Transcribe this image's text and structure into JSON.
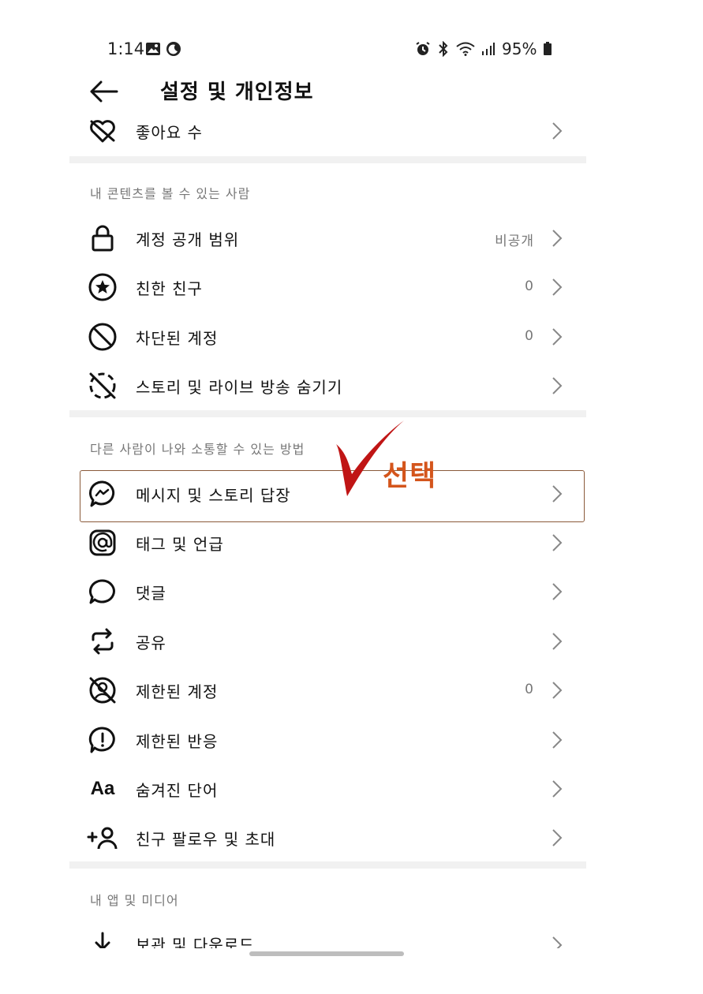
{
  "status_bar": {
    "time": "1:14",
    "battery": "95%"
  },
  "header": {
    "title": "설정 및 개인정보"
  },
  "top_item": {
    "label": "좋아요 수"
  },
  "sections": [
    {
      "title": "내 콘텐츠를 볼 수 있는 사람",
      "items": [
        {
          "label": "계정 공개 범위",
          "value": "비공개",
          "icon": "lock-icon"
        },
        {
          "label": "친한 친구",
          "value": "0",
          "icon": "star-circle-icon"
        },
        {
          "label": "차단된 계정",
          "value": "0",
          "icon": "block-icon"
        },
        {
          "label": "스토리 및 라이브 방송 숨기기",
          "value": "",
          "icon": "hide-story-icon"
        }
      ]
    },
    {
      "title": "다른 사람이 나와 소통할 수 있는 방법",
      "items": [
        {
          "label": "메시지 및 스토리 답장",
          "value": "",
          "icon": "messenger-icon"
        },
        {
          "label": "태그 및 언급",
          "value": "",
          "icon": "at-icon"
        },
        {
          "label": "댓글",
          "value": "",
          "icon": "comment-icon"
        },
        {
          "label": "공유",
          "value": "",
          "icon": "share-icon"
        },
        {
          "label": "제한된 계정",
          "value": "0",
          "icon": "restricted-icon"
        },
        {
          "label": "제한된 반응",
          "value": "",
          "icon": "alert-circle-icon"
        },
        {
          "label": "숨겨진 단어",
          "value": "",
          "icon": "text-aa-icon"
        },
        {
          "label": "친구 팔로우 및 초대",
          "value": "",
          "icon": "add-person-icon"
        }
      ]
    },
    {
      "title": "내 앱 및 미디어",
      "items": [
        {
          "label": "보관 및 다운로드",
          "value": "",
          "icon": "download-icon"
        }
      ]
    }
  ],
  "annotation": {
    "text": "선택",
    "color": "#d4551c"
  },
  "icons": {
    "aa_glyph": "Aa"
  }
}
